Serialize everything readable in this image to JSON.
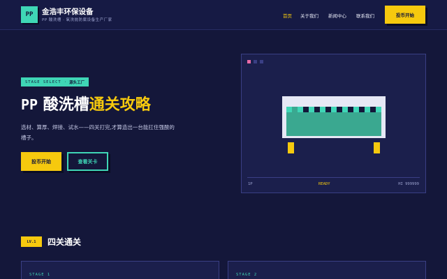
{
  "header": {
    "logo_text": "PP",
    "brand_name": "金浩丰环保设备",
    "brand_sub": "PP 酸洗槽 · 氧洗抛防腐设备生产厂家",
    "nav": [
      "首页",
      "关于我们",
      "新闻中心",
      "联系我们"
    ],
    "cta_label": "投币开始"
  },
  "hero": {
    "tag_a": "STAGE SELECT",
    "tag_sep": "·",
    "tag_b": "源头工厂",
    "title_prefix": "PP",
    "title_main": " 酸洗槽",
    "title_accent": "通关攻略",
    "description": "选材、算厚、焊接、试水——四关打完,才算造出一台能扛住强酸的槽子。",
    "primary_button": "投币开始",
    "secondary_button": "查看关卡"
  },
  "screen": {
    "footer_left": "1P",
    "footer_center": "READY",
    "footer_right": "HI 999999"
  },
  "section": {
    "badge": "LV.1",
    "title": "四关通关",
    "stages": [
      "STAGE 1",
      "STAGE 2"
    ]
  },
  "colors": {
    "background": "#14173a",
    "accent_yellow": "#f6c90e",
    "accent_teal": "#3fd6b6",
    "dot_pink": "#e86aa6",
    "panel": "#1b1f4c"
  },
  "icons": [
    "window-dots-icon",
    "pixel-tank-icon"
  ]
}
